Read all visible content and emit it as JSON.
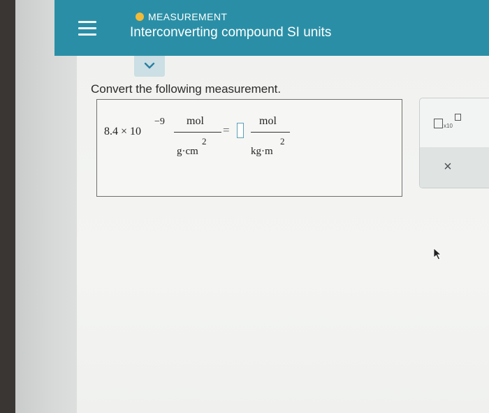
{
  "header": {
    "category": "MEASUREMENT",
    "title": "Interconverting compound SI units",
    "status_dot_color": "#f1bb39",
    "background_color": "#2a8fa6"
  },
  "icons": {
    "menu": "hamburger-icon",
    "collapse": "chevron-down-icon",
    "x10": "scientific-notation-icon",
    "clear": "close-icon"
  },
  "question": {
    "prompt": "Convert the following measurement.",
    "coefficient": "8.4 × 10",
    "exponent": "−9",
    "given_unit": {
      "numerator": "mol",
      "denominator": "g·cm",
      "denominator_exponent": "2"
    },
    "equals": "=",
    "answer_value": "",
    "target_unit": {
      "numerator": "mol",
      "denominator": "kg·m",
      "denominator_exponent": "2"
    }
  },
  "tools": {
    "x10_label": "x10",
    "clear_label": "×"
  }
}
